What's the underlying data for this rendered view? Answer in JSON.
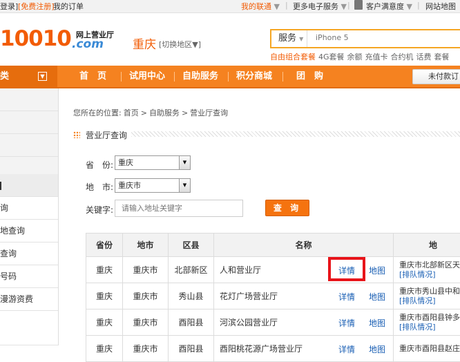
{
  "topbar": {
    "login": "登录]",
    "register": "[免费注册]",
    "my_orders": "我的订单",
    "my_unicom": "我的联通",
    "more_services": "更多电子服务",
    "satisfaction": "客户满意度",
    "site_map": "网站地图"
  },
  "header": {
    "logo_number": "10010",
    "logo_cn": "网上营业厅",
    "logo_domain": ".com",
    "city": "重庆",
    "switch_region": "[切换地区▼]",
    "search_type": "服务",
    "search_placeholder": "iPhone 5",
    "hot_links": [
      "自由组合套餐",
      "4G套餐",
      "余额",
      "充值卡",
      "合约机",
      "话费",
      "套餐"
    ]
  },
  "nav": {
    "category_label": "类",
    "items": [
      "首　页",
      "试用中心",
      "自助服务",
      "积分商城",
      "团　购"
    ],
    "unpaid": "未付款订"
  },
  "left_menu": [
    "",
    "",
    "",
    "",
    "询",
    "询",
    "地查询",
    "查询",
    "号码",
    "漫游资费"
  ],
  "breadcrumb": {
    "prefix": "您所在的位置:",
    "items": [
      "首页",
      "自助服务",
      "营业厅查询"
    ],
    "separator": ">"
  },
  "section_title": "营业厅查询",
  "form": {
    "province_label": "省　份:",
    "province_value": "重庆",
    "city_label": "地　市:",
    "city_value": "重庆市",
    "keyword_label": "关键字:",
    "keyword_placeholder": "请输入地址关键字",
    "query_button": "查 询"
  },
  "table": {
    "headers": [
      "省份",
      "地市",
      "区县",
      "名称",
      "地"
    ],
    "detail_label": "详情",
    "map_label": "地图",
    "queue_label": "[排队情况]",
    "rows": [
      {
        "province": "重庆",
        "city": "重庆市",
        "district": "北部新区",
        "name": "人和营业厅",
        "address": "重庆市北部新区天"
      },
      {
        "province": "重庆",
        "city": "重庆市",
        "district": "秀山县",
        "name": "花灯广场营业厅",
        "address": "重庆市秀山县中和"
      },
      {
        "province": "重庆",
        "city": "重庆市",
        "district": "酉阳县",
        "name": "河滨公园营业厅",
        "address": "重庆市酉阳县钟多"
      },
      {
        "province": "重庆",
        "city": "重庆市",
        "district": "酉阳县",
        "name": "酉阳桃花源广场营业厅",
        "address": "重庆市酉阳县赵庄"
      }
    ]
  },
  "colors": {
    "brand_orange": "#f58220",
    "link_blue": "#1a5fb4",
    "highlight_red": "#e8141a"
  }
}
